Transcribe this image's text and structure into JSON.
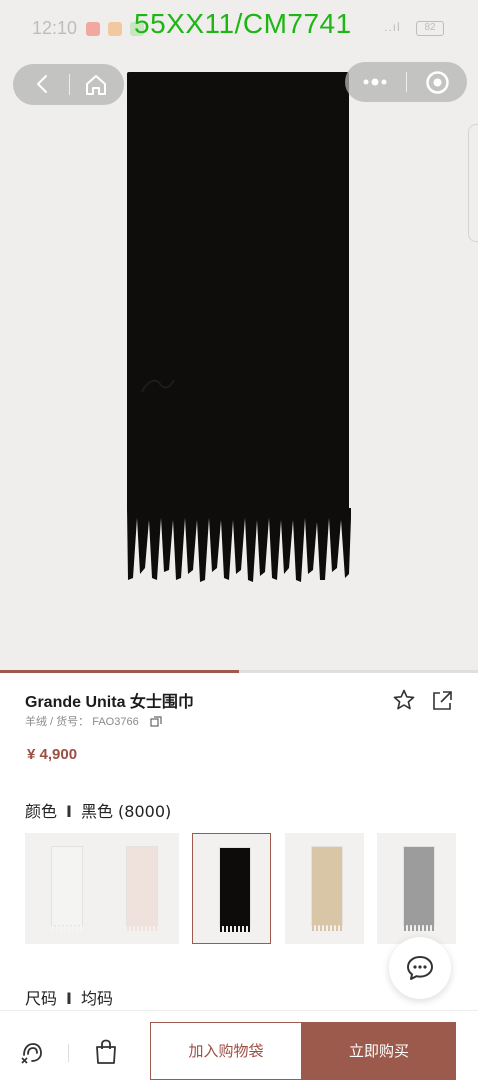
{
  "watermark": "55XX11/CM7741",
  "status_bar": {
    "time": "12:10",
    "signal": "..ıl",
    "battery": "82"
  },
  "gallery": {
    "progress": 0.5
  },
  "product": {
    "title": "Grande Unita 女士围巾",
    "subtitle": "羊绒 / 货号： FAO3766",
    "price": "¥ 4,900"
  },
  "color": {
    "label": "颜色",
    "separator": "I",
    "value": "黑色 (8000)"
  },
  "swatches": [
    {
      "color": "#f4f4f2",
      "selected": false
    },
    {
      "color": "#efe2dd",
      "selected": false
    },
    {
      "color": "#0d0c0b",
      "selected": true
    },
    {
      "color": "#d8c6a6",
      "selected": false
    },
    {
      "color": "#9c9c9c",
      "selected": false
    }
  ],
  "size": {
    "label": "尺码",
    "separator": "I",
    "value": "均码"
  },
  "actions": {
    "add_to_bag": "加入购物袋",
    "buy_now": "立即购买"
  },
  "icons": {
    "back": "chevron-left-icon",
    "home": "home-icon",
    "more": "more-dots-icon",
    "target": "target-icon",
    "favorite": "star-icon",
    "share": "share-icon",
    "copy": "copy-icon",
    "chat": "chat-icon",
    "service": "service-icon",
    "bag": "bag-icon"
  },
  "accent_color": "#9c4f43"
}
